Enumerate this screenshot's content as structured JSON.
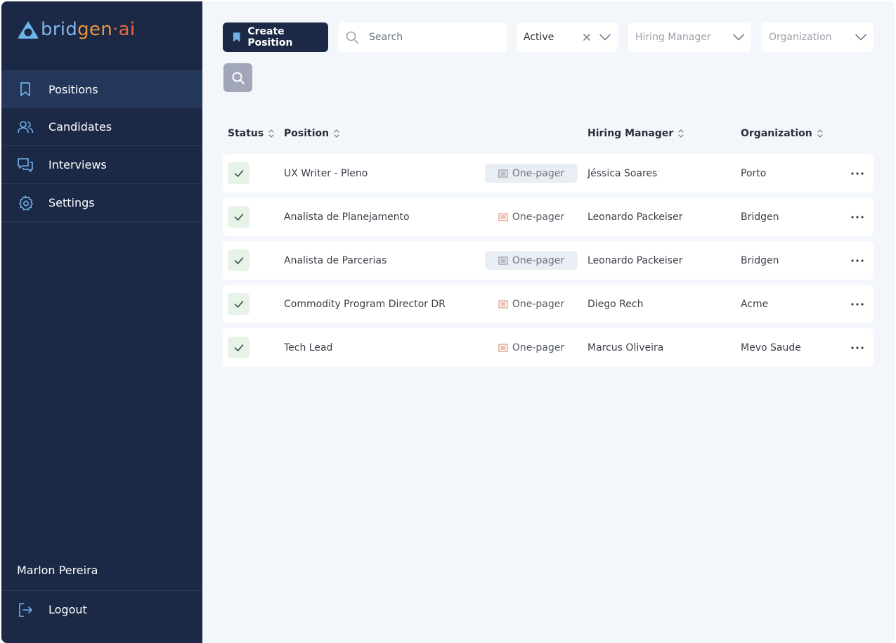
{
  "brand": {
    "part1": "brid",
    "part2": "gen",
    "part3": "·ai"
  },
  "sidebar": {
    "items": [
      {
        "label": "Positions",
        "icon": "bookmark-icon",
        "active": true
      },
      {
        "label": "Candidates",
        "icon": "users-icon",
        "active": false
      },
      {
        "label": "Interviews",
        "icon": "chat-icon",
        "active": false
      },
      {
        "label": "Settings",
        "icon": "gear-icon",
        "active": false
      }
    ],
    "user_name": "Marlon Pereira",
    "logout_label": "Logout"
  },
  "toolbar": {
    "create_label": "Create Position",
    "search_placeholder": "Search",
    "status_value": "Active",
    "hiring_manager_placeholder": "Hiring Manager",
    "organization_placeholder": "Organization"
  },
  "table": {
    "columns": [
      "Status",
      "Position",
      "Hiring Manager",
      "Organization"
    ],
    "rows": [
      {
        "position": "UX Writer - Pleno",
        "doc": "One-pager",
        "doc_highlight": true,
        "manager": "Jéssica Soares",
        "organization": "Porto"
      },
      {
        "position": "Analista de Planejamento",
        "doc": "One-pager",
        "doc_highlight": false,
        "manager": "Leonardo Packeiser",
        "organization": "Bridgen"
      },
      {
        "position": "Analista de Parcerias",
        "doc": "One-pager",
        "doc_highlight": true,
        "manager": "Leonardo Packeiser",
        "organization": "Bridgen"
      },
      {
        "position": "Commodity Program Director DR",
        "doc": "One-pager",
        "doc_highlight": false,
        "manager": "Diego Rech",
        "organization": "Acme"
      },
      {
        "position": "Tech Lead",
        "doc": "One-pager",
        "doc_highlight": false,
        "manager": "Marcus Oliveira",
        "organization": "Mevo Saude"
      }
    ]
  },
  "colors": {
    "sidebar_bg": "#1b2947",
    "accent": "#6fb3ea",
    "status_chip": "#e6f3e6",
    "doc_icon": "#d9866a"
  }
}
